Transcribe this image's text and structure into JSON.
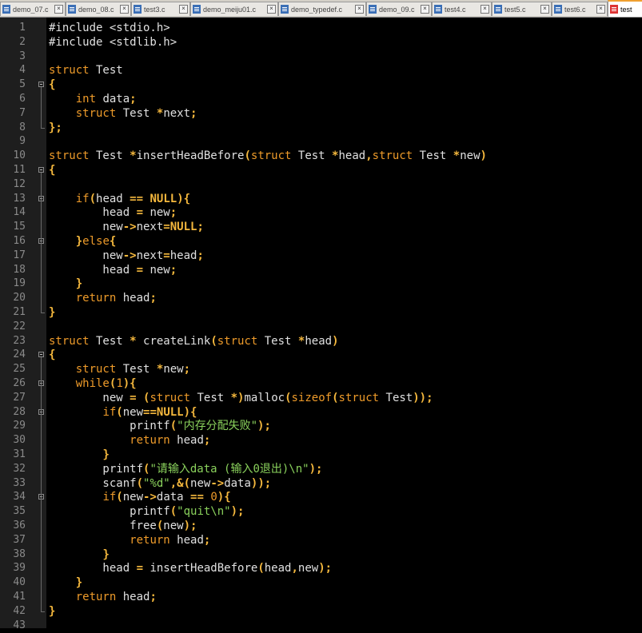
{
  "tabs": [
    {
      "label": "demo_07.c"
    },
    {
      "label": "demo_08.c"
    },
    {
      "label": "test3.c"
    },
    {
      "label": "demo_meiju01.c"
    },
    {
      "label": "demo_typedef.c"
    },
    {
      "label": "demo_09.c"
    },
    {
      "label": "test4.c"
    },
    {
      "label": "test5.c"
    },
    {
      "label": "test6.c"
    },
    {
      "label": "test"
    }
  ],
  "lines": [
    [
      [
        "ppd",
        "#include <stdio.h>"
      ]
    ],
    [
      [
        "ppd",
        "#include <stdlib.h>"
      ]
    ],
    [],
    [
      [
        "kw",
        "struct"
      ],
      [
        "id",
        " Test"
      ]
    ],
    [
      [
        "op",
        "{"
      ]
    ],
    [
      [
        "id",
        "    "
      ],
      [
        "kw",
        "int"
      ],
      [
        "id",
        " data"
      ],
      [
        "op",
        ";"
      ]
    ],
    [
      [
        "id",
        "    "
      ],
      [
        "kw",
        "struct"
      ],
      [
        "id",
        " Test "
      ],
      [
        "op",
        "*"
      ],
      [
        "id",
        "next"
      ],
      [
        "op",
        ";"
      ]
    ],
    [
      [
        "op",
        "};"
      ]
    ],
    [],
    [
      [
        "kw",
        "struct"
      ],
      [
        "id",
        " Test "
      ],
      [
        "op",
        "*"
      ],
      [
        "id",
        "insertHeadBefore"
      ],
      [
        "op",
        "("
      ],
      [
        "kw",
        "struct"
      ],
      [
        "id",
        " Test "
      ],
      [
        "op",
        "*"
      ],
      [
        "id",
        "head"
      ],
      [
        "op",
        ","
      ],
      [
        "kw",
        "struct"
      ],
      [
        "id",
        " Test "
      ],
      [
        "op",
        "*"
      ],
      [
        "id",
        "new"
      ],
      [
        "op",
        ")"
      ]
    ],
    [
      [
        "op",
        "{"
      ]
    ],
    [],
    [
      [
        "id",
        "    "
      ],
      [
        "kw",
        "if"
      ],
      [
        "op",
        "("
      ],
      [
        "id",
        "head "
      ],
      [
        "op",
        "=="
      ],
      [
        "id",
        " "
      ],
      [
        "cn",
        "NULL"
      ],
      [
        "op",
        "){"
      ]
    ],
    [
      [
        "id",
        "        head "
      ],
      [
        "op",
        "="
      ],
      [
        "id",
        " new"
      ],
      [
        "op",
        ";"
      ]
    ],
    [
      [
        "id",
        "        new"
      ],
      [
        "op",
        "->"
      ],
      [
        "id",
        "next"
      ],
      [
        "op",
        "="
      ],
      [
        "cn",
        "NULL"
      ],
      [
        "op",
        ";"
      ]
    ],
    [
      [
        "id",
        "    "
      ],
      [
        "op",
        "}"
      ],
      [
        "kw",
        "else"
      ],
      [
        "op",
        "{"
      ]
    ],
    [
      [
        "id",
        "        new"
      ],
      [
        "op",
        "->"
      ],
      [
        "id",
        "next"
      ],
      [
        "op",
        "="
      ],
      [
        "id",
        "head"
      ],
      [
        "op",
        ";"
      ]
    ],
    [
      [
        "id",
        "        head "
      ],
      [
        "op",
        "="
      ],
      [
        "id",
        " new"
      ],
      [
        "op",
        ";"
      ]
    ],
    [
      [
        "id",
        "    "
      ],
      [
        "op",
        "}"
      ]
    ],
    [
      [
        "id",
        "    "
      ],
      [
        "kw",
        "return"
      ],
      [
        "id",
        " head"
      ],
      [
        "op",
        ";"
      ]
    ],
    [
      [
        "op",
        "}"
      ]
    ],
    [],
    [
      [
        "kw",
        "struct"
      ],
      [
        "id",
        " Test "
      ],
      [
        "op",
        "*"
      ],
      [
        "id",
        " createLink"
      ],
      [
        "op",
        "("
      ],
      [
        "kw",
        "struct"
      ],
      [
        "id",
        " Test "
      ],
      [
        "op",
        "*"
      ],
      [
        "id",
        "head"
      ],
      [
        "op",
        ")"
      ]
    ],
    [
      [
        "op",
        "{"
      ]
    ],
    [
      [
        "id",
        "    "
      ],
      [
        "kw",
        "struct"
      ],
      [
        "id",
        " Test "
      ],
      [
        "op",
        "*"
      ],
      [
        "id",
        "new"
      ],
      [
        "op",
        ";"
      ]
    ],
    [
      [
        "id",
        "    "
      ],
      [
        "kw",
        "while"
      ],
      [
        "op",
        "("
      ],
      [
        "nm",
        "1"
      ],
      [
        "op",
        "){"
      ]
    ],
    [
      [
        "id",
        "        new "
      ],
      [
        "op",
        "="
      ],
      [
        "id",
        " "
      ],
      [
        "op",
        "("
      ],
      [
        "kw",
        "struct"
      ],
      [
        "id",
        " Test "
      ],
      [
        "op",
        "*)"
      ],
      [
        "id",
        "malloc"
      ],
      [
        "op",
        "("
      ],
      [
        "kw",
        "sizeof"
      ],
      [
        "op",
        "("
      ],
      [
        "kw",
        "struct"
      ],
      [
        "id",
        " Test"
      ],
      [
        "op",
        "));"
      ]
    ],
    [
      [
        "id",
        "        "
      ],
      [
        "kw",
        "if"
      ],
      [
        "op",
        "("
      ],
      [
        "id",
        "new"
      ],
      [
        "op",
        "=="
      ],
      [
        "cn",
        "NULL"
      ],
      [
        "op",
        "){"
      ]
    ],
    [
      [
        "id",
        "            printf"
      ],
      [
        "op",
        "("
      ],
      [
        "st",
        "\"内存分配失败\""
      ],
      [
        "op",
        ");"
      ]
    ],
    [
      [
        "id",
        "            "
      ],
      [
        "kw",
        "return"
      ],
      [
        "id",
        " head"
      ],
      [
        "op",
        ";"
      ]
    ],
    [
      [
        "id",
        "        "
      ],
      [
        "op",
        "}"
      ]
    ],
    [
      [
        "id",
        "        printf"
      ],
      [
        "op",
        "("
      ],
      [
        "st",
        "\"请输入data (输入0退出)\\n\""
      ],
      [
        "op",
        ");"
      ]
    ],
    [
      [
        "id",
        "        scanf"
      ],
      [
        "op",
        "("
      ],
      [
        "st",
        "\"%d\""
      ],
      [
        "op",
        ",&("
      ],
      [
        "id",
        "new"
      ],
      [
        "op",
        "->"
      ],
      [
        "id",
        "data"
      ],
      [
        "op",
        "));"
      ]
    ],
    [
      [
        "id",
        "        "
      ],
      [
        "kw",
        "if"
      ],
      [
        "op",
        "("
      ],
      [
        "id",
        "new"
      ],
      [
        "op",
        "->"
      ],
      [
        "id",
        "data "
      ],
      [
        "op",
        "=="
      ],
      [
        "id",
        " "
      ],
      [
        "nm",
        "0"
      ],
      [
        "op",
        "){"
      ]
    ],
    [
      [
        "id",
        "            printf"
      ],
      [
        "op",
        "("
      ],
      [
        "st",
        "\"quit\\n\""
      ],
      [
        "op",
        ");"
      ]
    ],
    [
      [
        "id",
        "            free"
      ],
      [
        "op",
        "("
      ],
      [
        "id",
        "new"
      ],
      [
        "op",
        ");"
      ]
    ],
    [
      [
        "id",
        "            "
      ],
      [
        "kw",
        "return"
      ],
      [
        "id",
        " head"
      ],
      [
        "op",
        ";"
      ]
    ],
    [
      [
        "id",
        "        "
      ],
      [
        "op",
        "}"
      ]
    ],
    [
      [
        "id",
        "        head "
      ],
      [
        "op",
        "="
      ],
      [
        "id",
        " insertHeadBefore"
      ],
      [
        "op",
        "("
      ],
      [
        "id",
        "head"
      ],
      [
        "op",
        ","
      ],
      [
        "id",
        "new"
      ],
      [
        "op",
        ");"
      ]
    ],
    [
      [
        "id",
        "    "
      ],
      [
        "op",
        "}"
      ]
    ],
    [
      [
        "id",
        "    "
      ],
      [
        "kw",
        "return"
      ],
      [
        "id",
        " head"
      ],
      [
        "op",
        ";"
      ]
    ],
    [
      [
        "op",
        "}"
      ]
    ],
    []
  ],
  "fold_markers": [
    5,
    11,
    13,
    16,
    24,
    26,
    28,
    34
  ]
}
